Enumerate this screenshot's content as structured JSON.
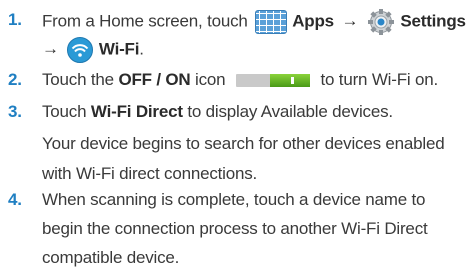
{
  "steps": [
    {
      "number": "1.",
      "line1": {
        "t1": "From a Home screen, touch",
        "apps": "Apps",
        "arrow1": "→",
        "settings": "Settings"
      },
      "line2": {
        "arrow": "→",
        "wifi": "Wi-Fi",
        "end": "."
      }
    },
    {
      "number": "2.",
      "t1": "Touch the",
      "bold": "OFF / ON",
      "t2": "icon",
      "t3": "to turn Wi-Fi on."
    },
    {
      "number": "3.",
      "t1": "Touch",
      "bold": "Wi-Fi Direct",
      "t2": "to display Available devices.",
      "line2": "Your device begins to search for other devices enabled",
      "line3": "with Wi-Fi direct connections."
    },
    {
      "number": "4.",
      "line1": "When scanning is complete, touch a device name to",
      "line2": "begin the connection process to another Wi-Fi Direct",
      "line3": "compatible device."
    }
  ],
  "icons": {
    "apps": "apps-grid-icon",
    "settings": "gear-icon",
    "wifi": "wifi-icon",
    "toggle": "on-off-toggle-icon"
  },
  "colors": {
    "step_number": "#1f7fc2",
    "text": "#3a3a3a"
  }
}
